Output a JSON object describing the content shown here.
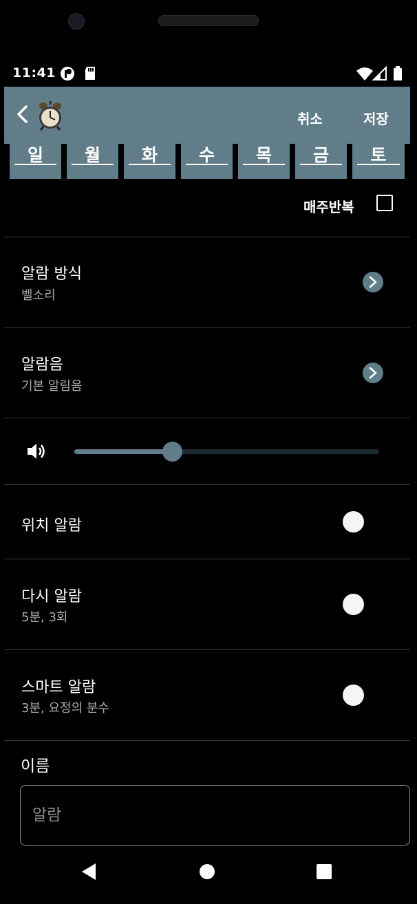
{
  "status_bar": {
    "time": "11:41"
  },
  "app_bar": {
    "cancel_label": "취소",
    "save_label": "저장"
  },
  "days": [
    "일",
    "월",
    "화",
    "수",
    "목",
    "금",
    "토"
  ],
  "repeat": {
    "label": "매주반복",
    "checked": false
  },
  "settings": [
    {
      "title": "알람 방식",
      "subtitle": "벨소리"
    },
    {
      "title": "알람음",
      "subtitle": "기본 알림음"
    }
  ],
  "volume": {
    "level_fraction": 0.32
  },
  "toggles": [
    {
      "title": "위치 알람",
      "subtitle": ""
    },
    {
      "title": "다시 알람",
      "subtitle": "5분, 3회"
    },
    {
      "title": "스마트 알람",
      "subtitle": "3분, 요정의 분수"
    }
  ],
  "name": {
    "label": "이름",
    "placeholder": "알람"
  },
  "colors": {
    "accent": "#617d8a",
    "background": "#000000"
  },
  "icons": [
    "back-arrow-icon",
    "alarm-clock-icon",
    "chevron-right-icon",
    "volume-icon",
    "wifi-icon",
    "signal-icon",
    "battery-icon",
    "sd-card-icon"
  ]
}
